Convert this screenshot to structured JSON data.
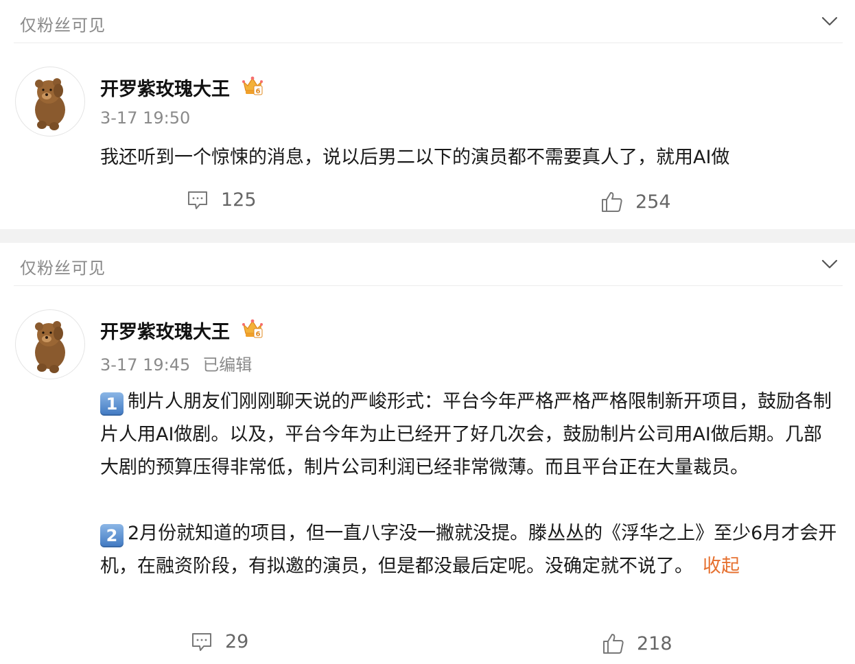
{
  "posts": [
    {
      "visibility": "仅粉丝可见",
      "username": "开罗紫玫瑰大王",
      "time": "3-17 19:50",
      "edited": "",
      "paragraphs": [
        "我还听到一个惊悚的消息，说以后男二以下的演员都不需要真人了，就用AI做"
      ],
      "comments": "125",
      "likes": "254"
    },
    {
      "visibility": "仅粉丝可见",
      "username": "开罗紫玫瑰大王",
      "time": "3-17 19:45",
      "edited": "已编辑",
      "paragraphs": [
        {
          "badge": "1",
          "text": "制片人朋友们刚刚聊天说的严峻形式：平台今年严格严格严格限制新开项目，鼓励各制片人用AI做剧。以及，平台今年为止已经开了好几次会，鼓励制片公司用AI做后期。几部大剧的预算压得非常低，制片公司利润已经非常微薄。而且平台正在大量裁员。"
        },
        {
          "badge": "2",
          "text": "2月份就知道的项目，但一直八字没一撇就没提。滕丛丛的《浮华之上》至少6月才会开机，在融资阶段，有拟邀的演员，但是都没最后定呢。没确定就不说了。"
        }
      ],
      "collapse_label": "收起",
      "comments": "29",
      "likes": "218"
    }
  ],
  "colors": {
    "accent": "#e6702f",
    "muted": "#8a8a8a",
    "separator": "#f2f2f2"
  },
  "icons": [
    "chevron-down-icon",
    "crown-badge-icon",
    "comment-icon",
    "thumbs-up-icon"
  ]
}
